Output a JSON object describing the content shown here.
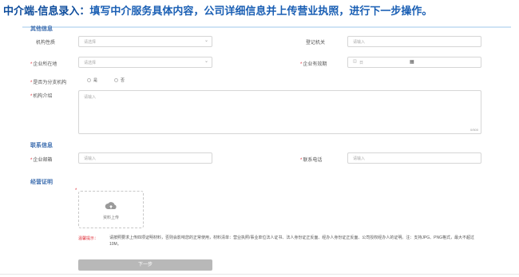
{
  "header": {
    "title_strong": "中介端-信息录入：",
    "title_rest": "填写中介服务具体内容，公司详细信息并上传营业执照，进行下一步操作。"
  },
  "sections": {
    "other_info": "其他信息",
    "contact_info": "联系信息",
    "business_cert": "经营证明"
  },
  "fields": {
    "org_nature": {
      "label": "机构性质",
      "required": "",
      "placeholder": "请选择"
    },
    "reg_authority": {
      "label": "登记机关",
      "required": "",
      "placeholder": "请输入"
    },
    "location": {
      "label": "企业所在地",
      "required": "*",
      "placeholder": "请选择"
    },
    "validity": {
      "label": "企业有效期",
      "required": "*",
      "placeholder": "日"
    },
    "branch": {
      "label": "是否为分支机构",
      "required": "*",
      "opt_yes": "是",
      "opt_no": "否"
    },
    "intro": {
      "label": "机构介绍",
      "required": "*",
      "placeholder": "请输入",
      "counter": "0/500"
    },
    "email": {
      "label": "企业邮箱",
      "required": "*",
      "placeholder": "请输入"
    },
    "phone": {
      "label": "联系电话",
      "required": "*",
      "placeholder": "请输入"
    }
  },
  "upload": {
    "required": "*",
    "label": "资料上传"
  },
  "tips": {
    "label": "温馨提示：",
    "text": "请按照要求上传四项证明材料，否则会影响您的正常使用，材料清单：营业执照/事业单位法人证书、法人身份证正反面、经办人身份证正反面、公司授权经办人的证明。注：支持JPG、PNG格式，最大不超过10M。"
  },
  "next_button": "下一步"
}
